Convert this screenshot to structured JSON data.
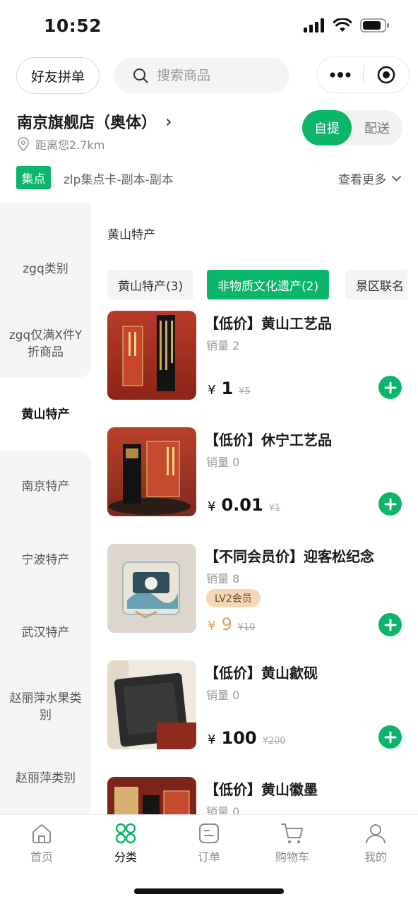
{
  "status_bar": {
    "time": "10:52"
  },
  "header": {
    "friend_button": "好友拼单",
    "search_placeholder": "搜索商品"
  },
  "store": {
    "name": "南京旗舰店（奥体）",
    "chevron": "›",
    "distance": "距离您2.7km",
    "modes": [
      "自提",
      "配送"
    ],
    "active_mode": "自提"
  },
  "points": {
    "badge": "集点",
    "text": "zlp集点卡-副本-副本",
    "see_more": "查看更多"
  },
  "sidebar": {
    "items": [
      {
        "label": "zgq类别"
      },
      {
        "label": "zgq仅满X件Y折商品"
      },
      {
        "label": "黄山特产",
        "active": true
      },
      {
        "label": "南京特产"
      },
      {
        "label": "宁波特产"
      },
      {
        "label": "武汉特产"
      },
      {
        "label": "赵丽萍水果类别"
      },
      {
        "label": "赵丽萍类别"
      }
    ]
  },
  "main": {
    "section_title": "黄山特产",
    "chips": [
      {
        "label": "黄山特产(3)"
      },
      {
        "label": "非物质文化遗产(2)",
        "active": true
      },
      {
        "label": "景区联名"
      }
    ],
    "products": [
      {
        "name": "【低价】黄山工艺品",
        "sales": "销量 2",
        "currency": "¥",
        "price": "1",
        "original": "¥5"
      },
      {
        "name": "【低价】休宁工艺品",
        "sales": "销量 0",
        "currency": "¥",
        "price": "0.01",
        "original": "¥1"
      },
      {
        "name": "【不同会员价】迎客松纪念",
        "sales": "销量 8",
        "member_tag": "LV2会员",
        "currency": "¥",
        "price": "9",
        "original": "¥10"
      },
      {
        "name": "【低价】黄山歙砚",
        "sales": "销量 0",
        "currency": "¥",
        "price": "100",
        "original": "¥200"
      },
      {
        "name": "【低价】黄山徽墨",
        "sales": "销量 0"
      }
    ]
  },
  "tabbar": {
    "items": [
      {
        "label": "首页",
        "icon": "home-icon"
      },
      {
        "label": "分类",
        "icon": "category-icon",
        "active": true
      },
      {
        "label": "订单",
        "icon": "order-icon"
      },
      {
        "label": "购物车",
        "icon": "cart-icon"
      },
      {
        "label": "我的",
        "icon": "profile-icon"
      }
    ]
  },
  "colors": {
    "accent": "#0bb56a",
    "member_price": "#e0a05a",
    "member_tag_bg": "#f3d7b6"
  }
}
